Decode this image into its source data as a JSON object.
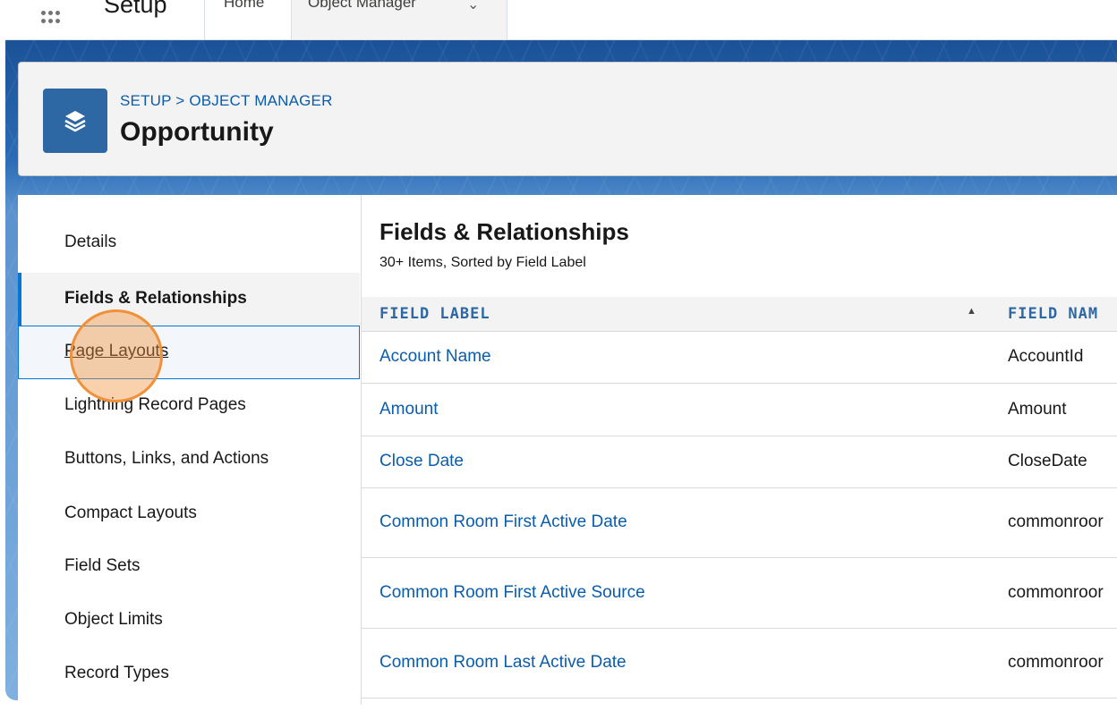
{
  "topnav": {
    "app_name": "Setup",
    "tabs": [
      {
        "label": "Home"
      },
      {
        "label": "Object Manager"
      }
    ]
  },
  "header": {
    "breadcrumb": "SETUP > OBJECT MANAGER",
    "title": "Opportunity",
    "icon": "layers-icon"
  },
  "sidebar": {
    "items": [
      {
        "label": "Details"
      },
      {
        "label": "Fields & Relationships"
      },
      {
        "label": "Page Layouts"
      },
      {
        "label": "Lightning Record Pages"
      },
      {
        "label": "Buttons, Links, and Actions"
      },
      {
        "label": "Compact Layouts"
      },
      {
        "label": "Field Sets"
      },
      {
        "label": "Object Limits"
      },
      {
        "label": "Record Types"
      }
    ],
    "active_index": 1,
    "hovered_index": 2
  },
  "content": {
    "title": "Fields & Relationships",
    "subtitle": "30+ Items, Sorted by Field Label",
    "columns": [
      "FIELD LABEL",
      "FIELD NAM"
    ],
    "rows": [
      {
        "label": "Account Name",
        "name": "AccountId"
      },
      {
        "label": "Amount",
        "name": "Amount"
      },
      {
        "label": "Close Date",
        "name": "CloseDate"
      },
      {
        "label": "Common Room First Active Date",
        "name": "commonroor"
      },
      {
        "label": "Common Room First Active Source",
        "name": "commonroor"
      },
      {
        "label": "Common Room Last Active Date",
        "name": "commonroor"
      }
    ]
  },
  "colors": {
    "link": "#0b5cab",
    "active_indicator": "#0176d3",
    "icon_bg": "#2e68a4",
    "click_highlight": "#f0913a"
  }
}
